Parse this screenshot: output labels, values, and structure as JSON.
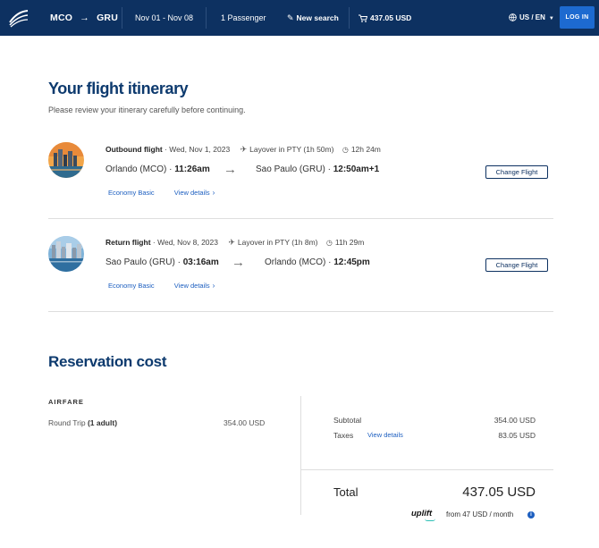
{
  "header": {
    "origin": "MCO",
    "route_arrow": "→",
    "destination": "GRU",
    "dates": "Nov 01 - Nov 08",
    "passengers": "1 Passenger",
    "new_search": "New search",
    "cart_total": "437.05 USD",
    "locale": "US / EN",
    "login": "LOG IN",
    "icons": [
      "logo",
      "pencil-icon",
      "cart-icon",
      "globe-icon",
      "chevron-down-icon"
    ]
  },
  "itinerary": {
    "title": "Your flight itinerary",
    "subtitle": "Please review your itinerary carefully before continuing.",
    "flights": [
      {
        "label": "Outbound flight",
        "date": "· Wed, Nov 1, 2023",
        "layover": "Layover in PTY (1h 50m)",
        "duration": "12h 24m",
        "from_city": "Orlando (MCO) ·",
        "from_time": "11:26am",
        "to_city": "Sao Paulo (GRU) ·",
        "to_time": "12:50am+1",
        "fare": "Economy Basic",
        "view_details": "View details",
        "change": "Change Flight"
      },
      {
        "label": "Return flight",
        "date": "· Wed, Nov 8, 2023",
        "layover": "Layover in PTY (1h 8m)",
        "duration": "11h 29m",
        "from_city": "Sao Paulo (GRU) ·",
        "from_time": "03:16am",
        "to_city": "Orlando (MCO) ·",
        "to_time": "12:45pm",
        "fare": "Economy Basic",
        "view_details": "View details",
        "change": "Change Flight"
      }
    ]
  },
  "reservation": {
    "title": "Reservation cost",
    "airfare_label": "AIRFARE",
    "round_trip_label": "Round Trip",
    "round_trip_pax": "(1 adult)",
    "round_trip_value": "354.00 USD",
    "subtotal_label": "Subtotal",
    "subtotal_value": "354.00 USD",
    "taxes_label": "Taxes",
    "taxes_link": "View details",
    "taxes_value": "83.05 USD",
    "total_label": "Total",
    "total_value": "437.05 USD",
    "uplift_brand": "uplift",
    "uplift_text": "from 47 USD / month",
    "info_glyph": "i"
  },
  "colors": {
    "header_bg": "#0d3161",
    "title": "#0d3a6e",
    "link": "#1d5fc0",
    "login_bg": "#1d6ad0"
  }
}
